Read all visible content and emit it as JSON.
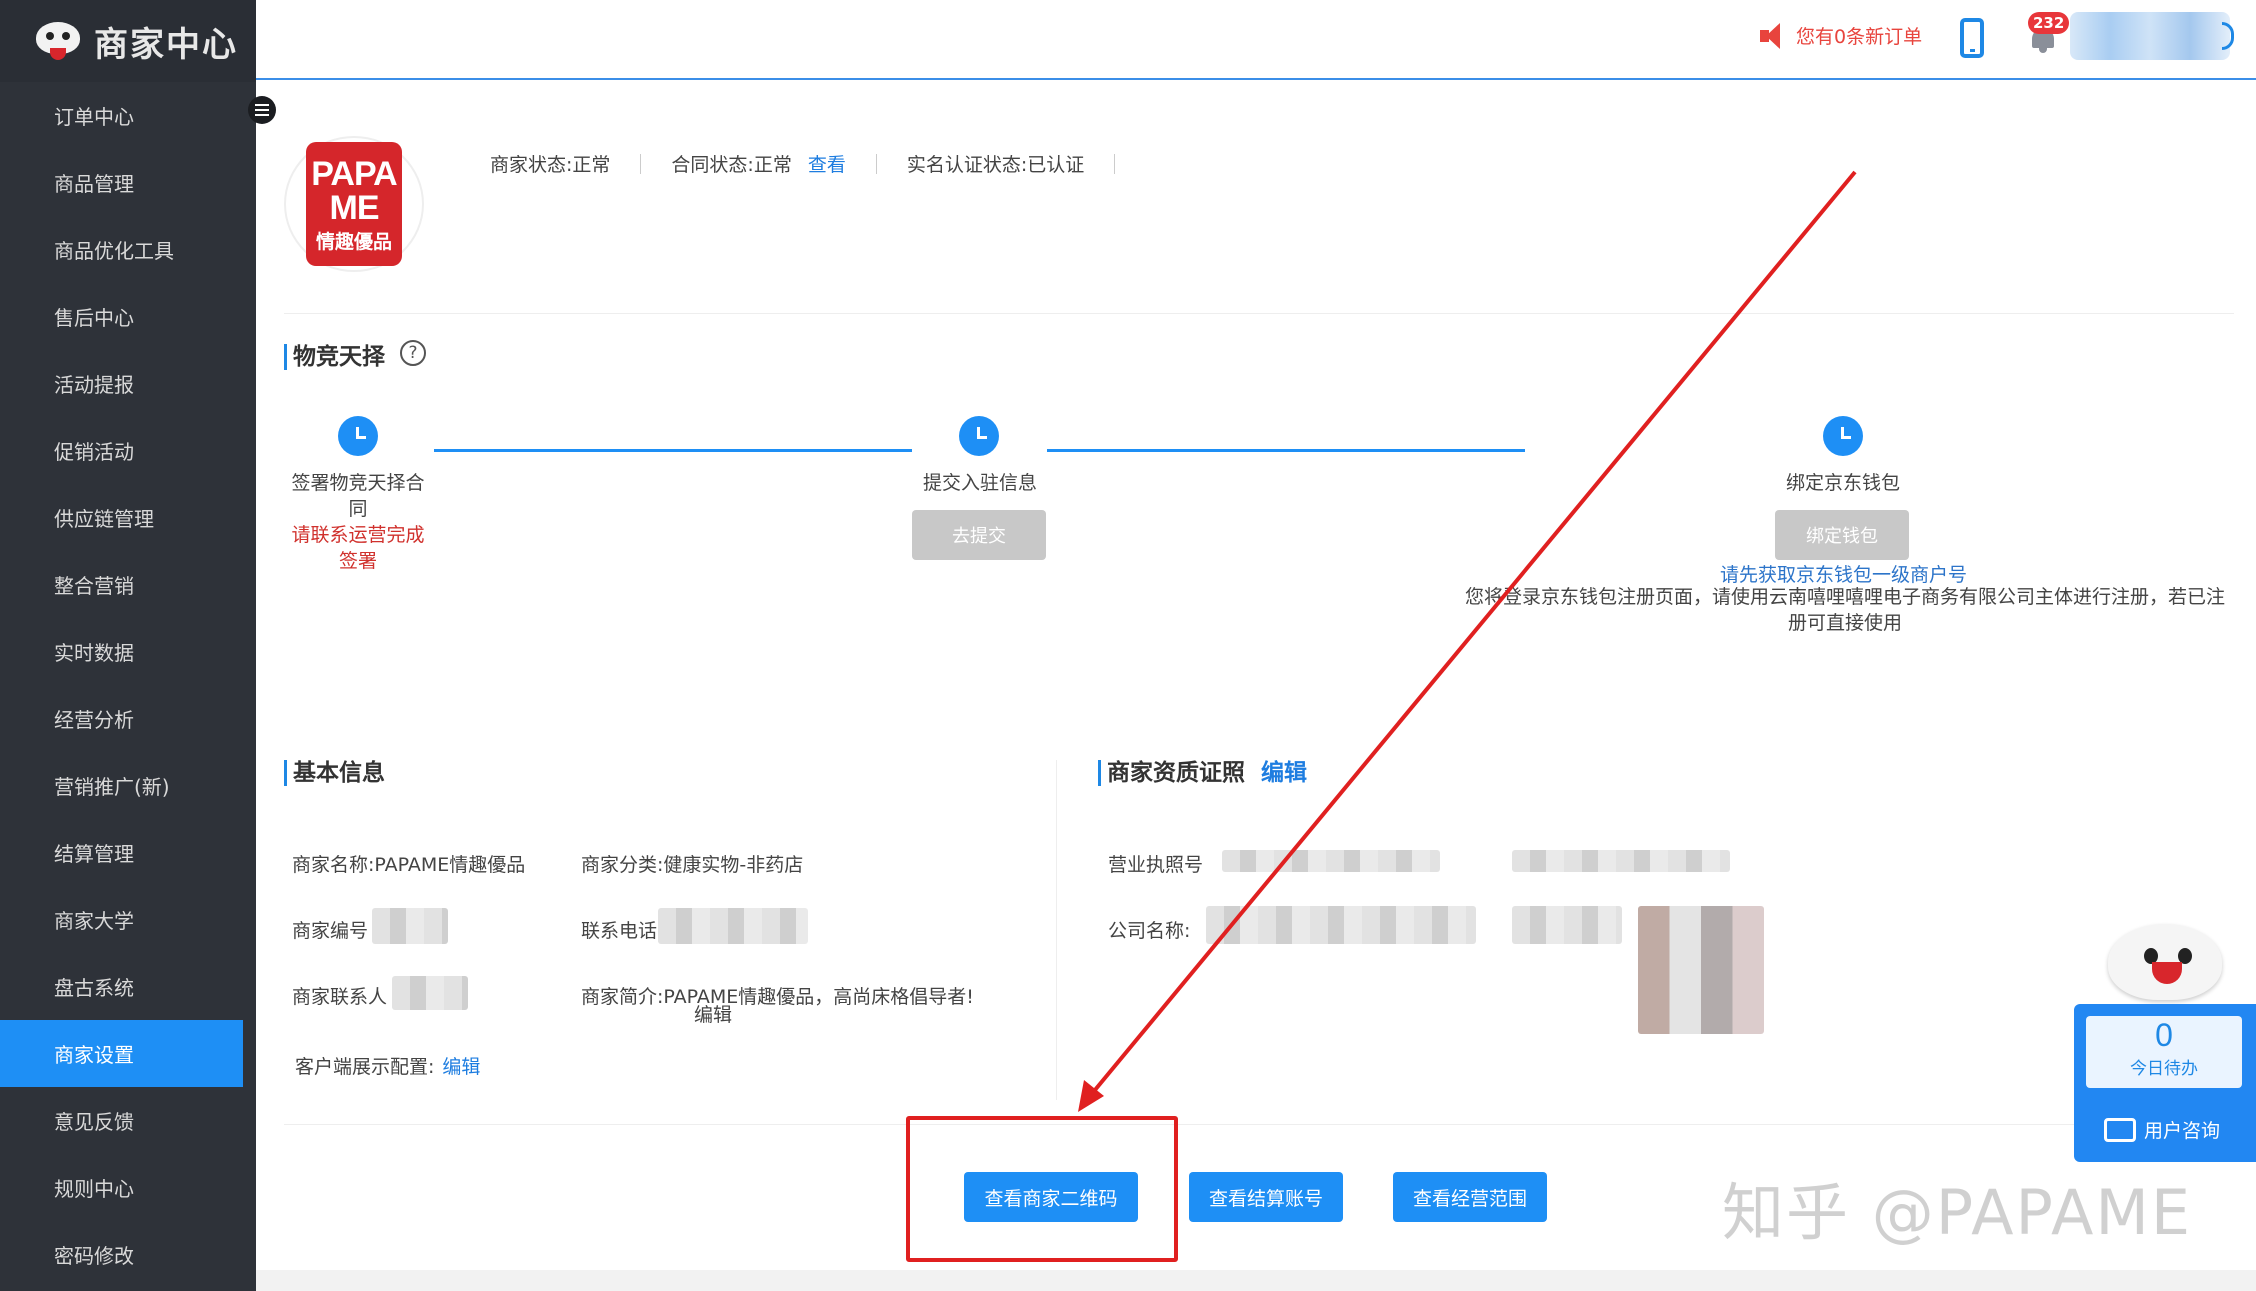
{
  "app": {
    "title": "商家中心"
  },
  "sidebar": {
    "items": [
      {
        "label": "订单中心"
      },
      {
        "label": "商品管理"
      },
      {
        "label": "商品优化工具"
      },
      {
        "label": "售后中心"
      },
      {
        "label": "活动提报"
      },
      {
        "label": "促销活动"
      },
      {
        "label": "供应链管理"
      },
      {
        "label": "整合营销"
      },
      {
        "label": "实时数据"
      },
      {
        "label": "经营分析"
      },
      {
        "label": "营销推广(新)"
      },
      {
        "label": "结算管理"
      },
      {
        "label": "商家大学"
      },
      {
        "label": "盘古系统"
      },
      {
        "label": "商家设置",
        "active": true
      },
      {
        "label": "意见反馈"
      },
      {
        "label": "规则中心"
      },
      {
        "label": "密码修改"
      }
    ]
  },
  "header": {
    "order_notice": "您有0条新订单",
    "bell_badge": "232"
  },
  "store": {
    "logo_line1": "PAPA",
    "logo_line2": "ME",
    "logo_line3": "情趣優品"
  },
  "status": {
    "merchant_label": "商家状态:",
    "merchant_value": "正常",
    "contract_label": "合同状态:",
    "contract_value": "正常",
    "contract_link": "查看",
    "realname_label": "实名认证状态:",
    "realname_value": "已认证"
  },
  "logistics": {
    "title": "物竞天择",
    "steps": [
      {
        "label": "签署物竞天择合同",
        "note": "请联系运营完成签署"
      },
      {
        "label": "提交入驻信息",
        "button": "去提交"
      },
      {
        "label": "绑定京东钱包",
        "button": "绑定钱包"
      }
    ],
    "wallet_hint": "请先获取京东钱包一级商户号",
    "wallet_desc": "您将登录京东钱包注册页面，请使用云南嘻哩嘻哩电子商务有限公司主体进行注册，若已注册可直接使用"
  },
  "basic_info": {
    "title": "基本信息",
    "name_label": "商家名称:",
    "name_value": "PAPAME情趣優品",
    "category_label": "商家分类:",
    "category_value": "健康实物-非药店",
    "id_label": "商家编号",
    "phone_label": "联系电话",
    "contact_label": "商家联系人",
    "intro_label": "商家简介:",
    "intro_value": "PAPAME情趣優品，高尚床格倡导者!",
    "intro_edit": "编辑",
    "client_label": "客户端展示配置:",
    "client_edit": "编辑"
  },
  "license": {
    "title": "商家资质证照",
    "edit": "编辑",
    "license_label": "营业执照号",
    "company_label": "公司名称:"
  },
  "actions": {
    "qrcode": "查看商家二维码",
    "settlement": "查看结算账号",
    "scope": "查看经营范围"
  },
  "widget": {
    "todo_count": "0",
    "todo_label": "今日待办",
    "consult": "用户咨询"
  },
  "watermark": "知乎 @PAPAME",
  "colors": {
    "accent": "#1e8ff5",
    "sidebar_bg": "#2e3239",
    "alert_red": "#e02020"
  }
}
